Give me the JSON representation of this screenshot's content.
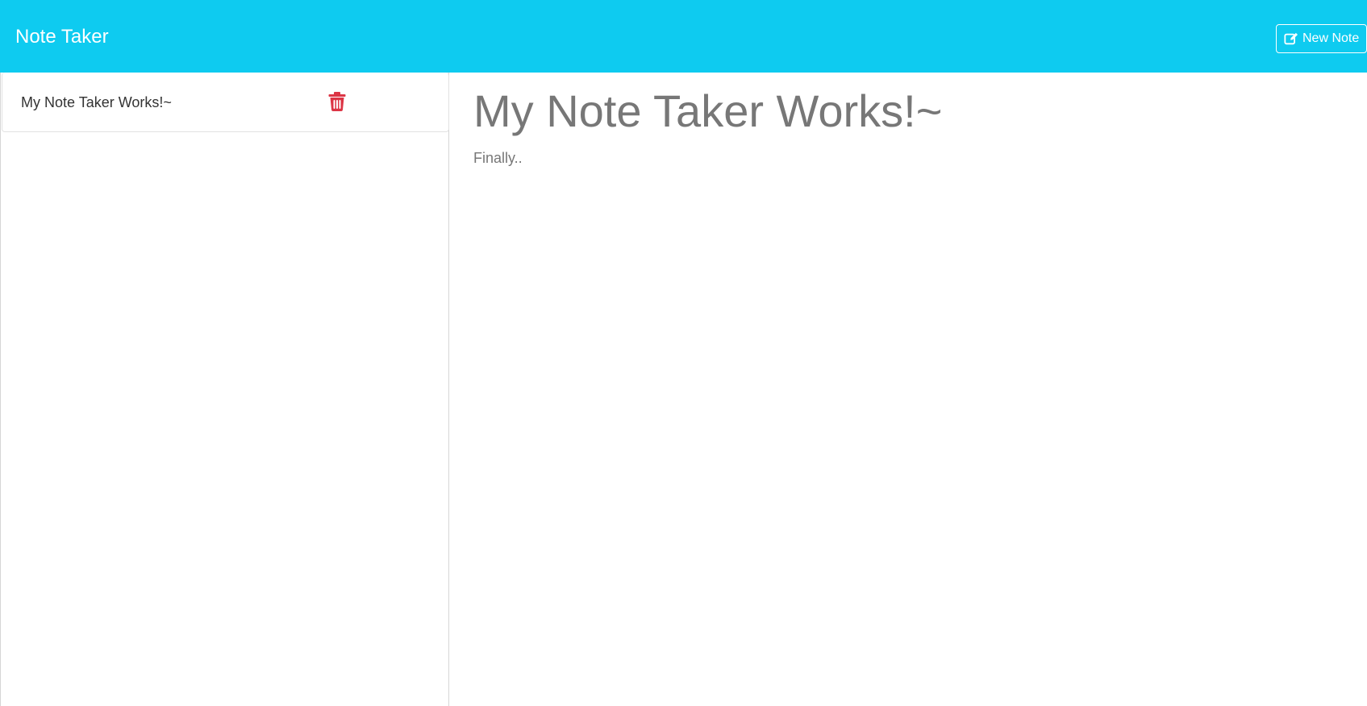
{
  "navbar": {
    "brand": "Note Taker",
    "new_note_label": "New Note",
    "new_note_icon": "pen-to-square-icon",
    "background_color": "#0ecbf0"
  },
  "sidebar": {
    "notes": [
      {
        "title": "My Note Taker Works!~",
        "delete_icon": "trash-icon",
        "delete_color": "#dc3545"
      }
    ]
  },
  "editor": {
    "title": "My Note Taker Works!~",
    "text": "Finally.."
  }
}
